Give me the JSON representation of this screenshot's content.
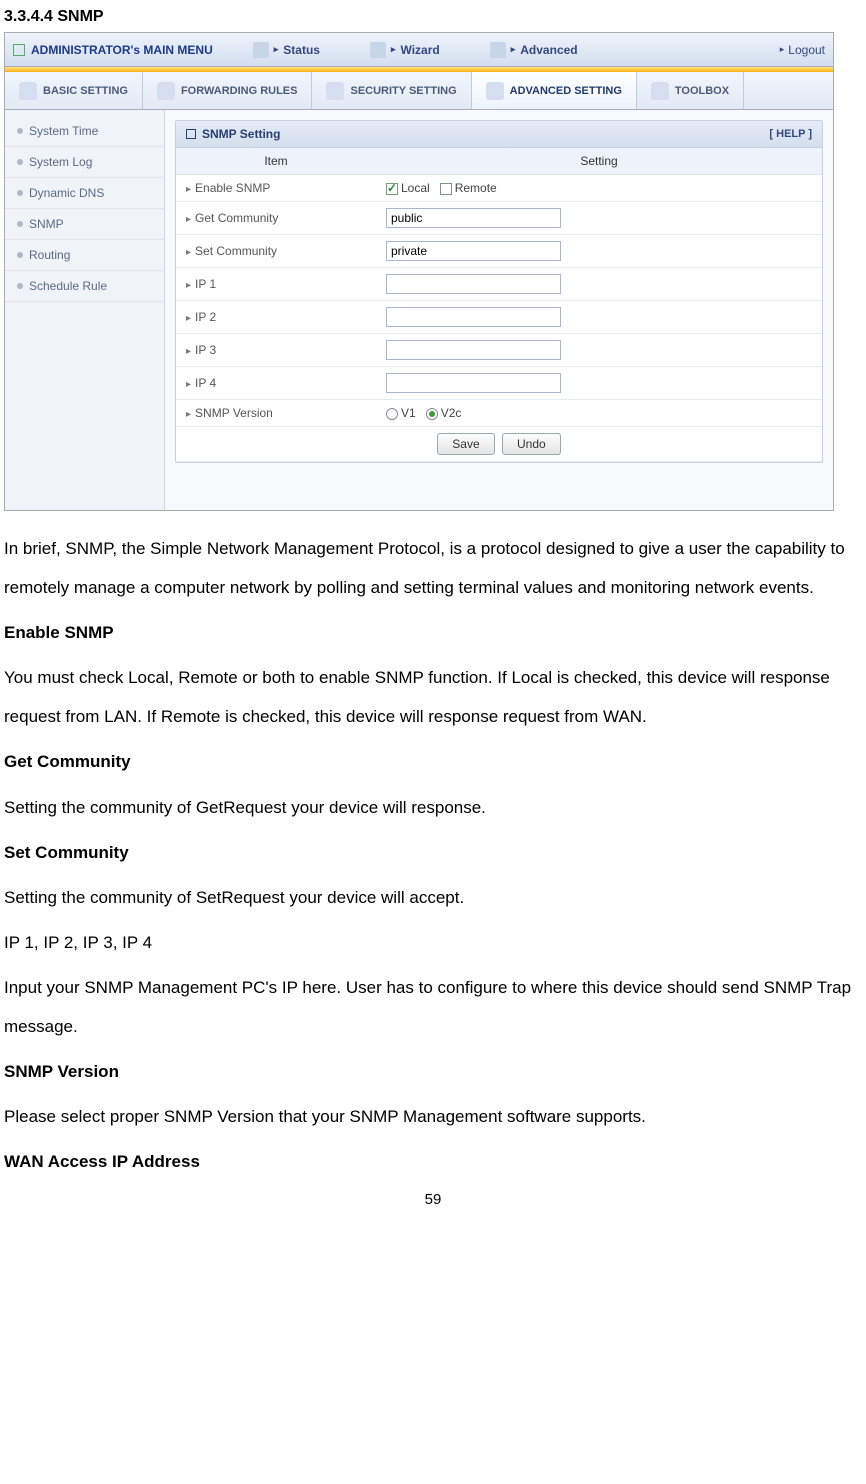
{
  "doc": {
    "section_heading": "3.3.4.4 SNMP",
    "page_number": "59"
  },
  "ui": {
    "top": {
      "admin_title": "ADMINISTRATOR's MAIN MENU",
      "items": [
        {
          "label": "Status"
        },
        {
          "label": "Wizard"
        },
        {
          "label": "Advanced"
        }
      ],
      "logout": "Logout"
    },
    "tabs": [
      {
        "label": "BASIC SETTING"
      },
      {
        "label": "FORWARDING RULES"
      },
      {
        "label": "SECURITY SETTING"
      },
      {
        "label": "ADVANCED SETTING"
      },
      {
        "label": "TOOLBOX"
      }
    ],
    "sidebar": [
      {
        "label": "System Time"
      },
      {
        "label": "System Log"
      },
      {
        "label": "Dynamic DNS"
      },
      {
        "label": "SNMP"
      },
      {
        "label": "Routing"
      },
      {
        "label": "Schedule Rule"
      }
    ],
    "panel": {
      "title": "SNMP Setting",
      "help": "[ HELP ]",
      "headers": {
        "item": "Item",
        "setting": "Setting"
      },
      "rows": {
        "enable": {
          "label": "Enable SNMP",
          "local": "Local",
          "remote": "Remote"
        },
        "get_comm": {
          "label": "Get Community",
          "value": "public"
        },
        "set_comm": {
          "label": "Set Community",
          "value": "private"
        },
        "ip1": {
          "label": "IP 1",
          "value": ""
        },
        "ip2": {
          "label": "IP 2",
          "value": ""
        },
        "ip3": {
          "label": "IP 3",
          "value": ""
        },
        "ip4": {
          "label": "IP 4",
          "value": ""
        },
        "version": {
          "label": "SNMP Version",
          "v1": "V1",
          "v2c": "V2c"
        }
      },
      "buttons": {
        "save": "Save",
        "undo": "Undo"
      }
    }
  },
  "text": {
    "intro": "In brief, SNMP, the Simple Network Management Protocol, is a protocol designed to give a user the capability to remotely manage a computer network by polling and setting terminal values and monitoring network events.",
    "h_enable": "Enable SNMP",
    "p_enable": "You must check Local, Remote or both to enable SNMP function. If Local is checked, this device will response request from LAN. If Remote is checked, this device will response request from WAN.",
    "h_get": "Get Community",
    "p_get": "Setting the community of GetRequest your device will response.",
    "h_set": "Set Community",
    "p_set": "Setting the community of SetRequest your device will accept.",
    "h_ips": "IP 1, IP 2, IP 3, IP 4",
    "p_ips": "Input your SNMP Management PC's IP here. User has to configure to where this device should send SNMP Trap message.",
    "h_ver": "SNMP Version",
    "p_ver": "Please select proper SNMP Version that your SNMP Management software supports.",
    "h_wan": "WAN Access IP Address"
  }
}
